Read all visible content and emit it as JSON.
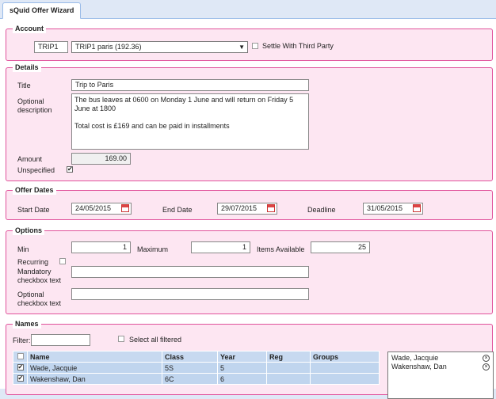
{
  "tab": {
    "label": "sQuid Offer Wizard"
  },
  "account": {
    "legend": "Account",
    "code": "TRIP1",
    "selected": "TRIP1 paris (192.36)",
    "settle_label": "Settle With Third Party",
    "settle_checked": false
  },
  "details": {
    "legend": "Details",
    "title_label": "Title",
    "title_value": "Trip to Paris",
    "desc_label": "Optional description",
    "desc_value": "The bus leaves at 0600 on Monday 1 June and will return on Friday 5 June at 1800\n\nTotal cost is £169 and can be paid in installments",
    "amount_label": "Amount",
    "amount_value": "169.00",
    "unspecified_label": "Unspecified",
    "unspecified_checked": true
  },
  "dates": {
    "legend": "Offer Dates",
    "start_label": "Start Date",
    "start_value": "24/05/2015",
    "end_label": "End Date",
    "end_value": "29/07/2015",
    "deadline_label": "Deadline",
    "deadline_value": "31/05/2015"
  },
  "options": {
    "legend": "Options",
    "min_label": "Min",
    "min_value": "1",
    "max_label": "Maximum",
    "max_value": "1",
    "items_label": "Items Available",
    "items_value": "25",
    "recurring_label": "Recurring",
    "recurring_checked": false,
    "mandatory_label": "Mandatory checkbox text",
    "mandatory_value": "",
    "optional_label": "Optional checkbox text",
    "optional_value": ""
  },
  "names": {
    "legend": "Names",
    "filter_label": "Filter:",
    "filter_value": "",
    "select_all_label": "Select all filtered",
    "columns": [
      "Name",
      "Class",
      "Year",
      "Reg",
      "Groups"
    ],
    "rows": [
      {
        "checked": true,
        "name": "Wade, Jacquie",
        "class": "5S",
        "year": "5",
        "reg": "",
        "groups": ""
      },
      {
        "checked": true,
        "name": "Wakenshaw, Dan",
        "class": "6C",
        "year": "6",
        "reg": "",
        "groups": ""
      }
    ],
    "selected": [
      "Wade, Jacquie",
      "Wakenshaw, Dan"
    ]
  }
}
